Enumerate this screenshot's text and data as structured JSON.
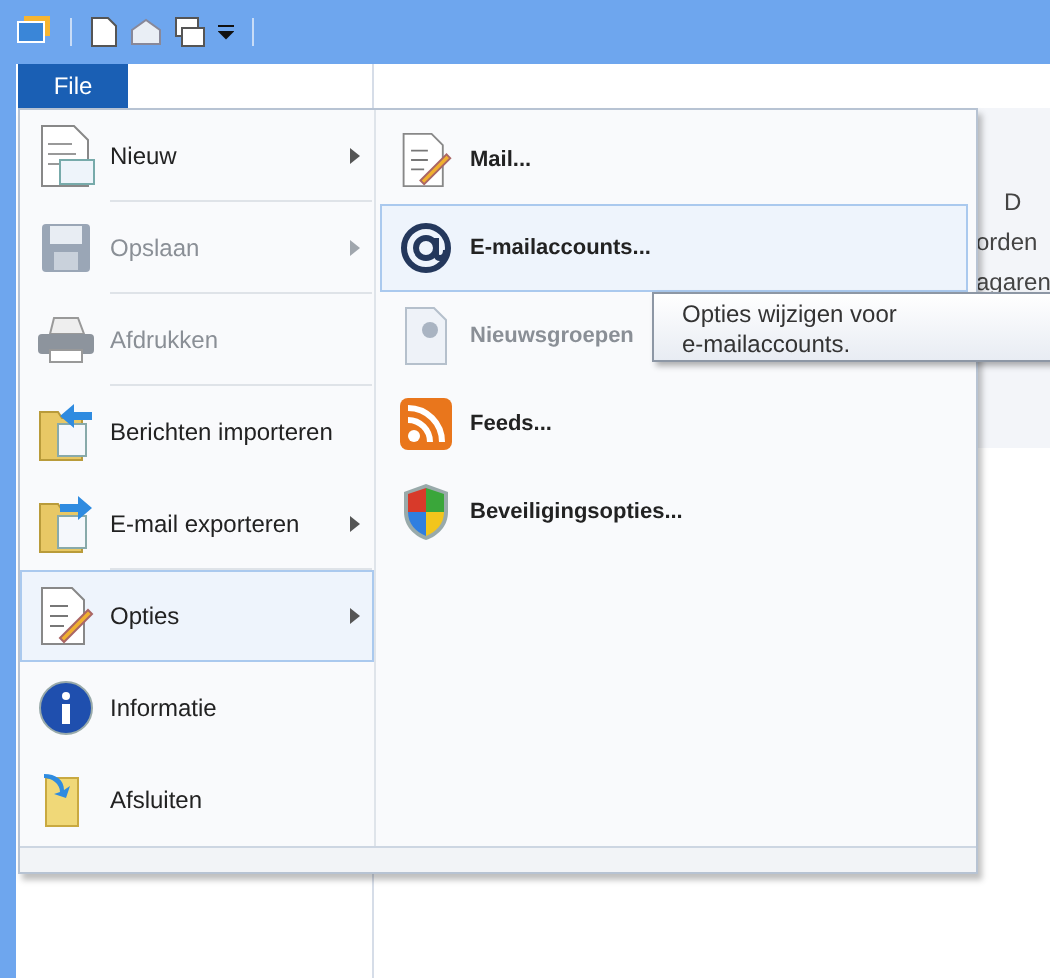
{
  "menu_tab": {
    "label": "File",
    "selected": true
  },
  "left_items": [
    {
      "label": "Nieuw",
      "disabled": false,
      "submenu": true,
      "selected": false,
      "separator_after": true
    },
    {
      "label": "Opslaan",
      "disabled": true,
      "submenu": true,
      "selected": false,
      "separator_after": true
    },
    {
      "label": "Afdrukken",
      "disabled": true,
      "submenu": false,
      "selected": false,
      "separator_after": true
    },
    {
      "label": "Berichten importeren",
      "disabled": false,
      "submenu": false,
      "selected": false,
      "separator_after": false
    },
    {
      "label": "E-mail exporteren",
      "disabled": false,
      "submenu": true,
      "selected": false,
      "separator_after": true
    },
    {
      "label": "Opties",
      "disabled": false,
      "submenu": true,
      "selected": true,
      "separator_after": false
    },
    {
      "label": "Informatie",
      "disabled": false,
      "submenu": false,
      "selected": false,
      "separator_after": false
    },
    {
      "label": "Afsluiten",
      "disabled": false,
      "submenu": false,
      "selected": false,
      "separator_after": false
    }
  ],
  "submenu_items": [
    {
      "label": "Mail...",
      "disabled": false,
      "selected": false
    },
    {
      "label": "E-mailaccounts...",
      "disabled": false,
      "selected": true
    },
    {
      "label": "Nieuwsgroepen",
      "disabled": true,
      "selected": false
    },
    {
      "label": "Feeds...",
      "disabled": false,
      "selected": false
    },
    {
      "label": "Beveiligingsopties...",
      "disabled": false,
      "selected": false
    }
  ],
  "tooltip": [
    "Opties wijzigen voor",
    "e-mailaccounts."
  ],
  "background_texts": [
    "D",
    "orden",
    "agaren"
  ]
}
